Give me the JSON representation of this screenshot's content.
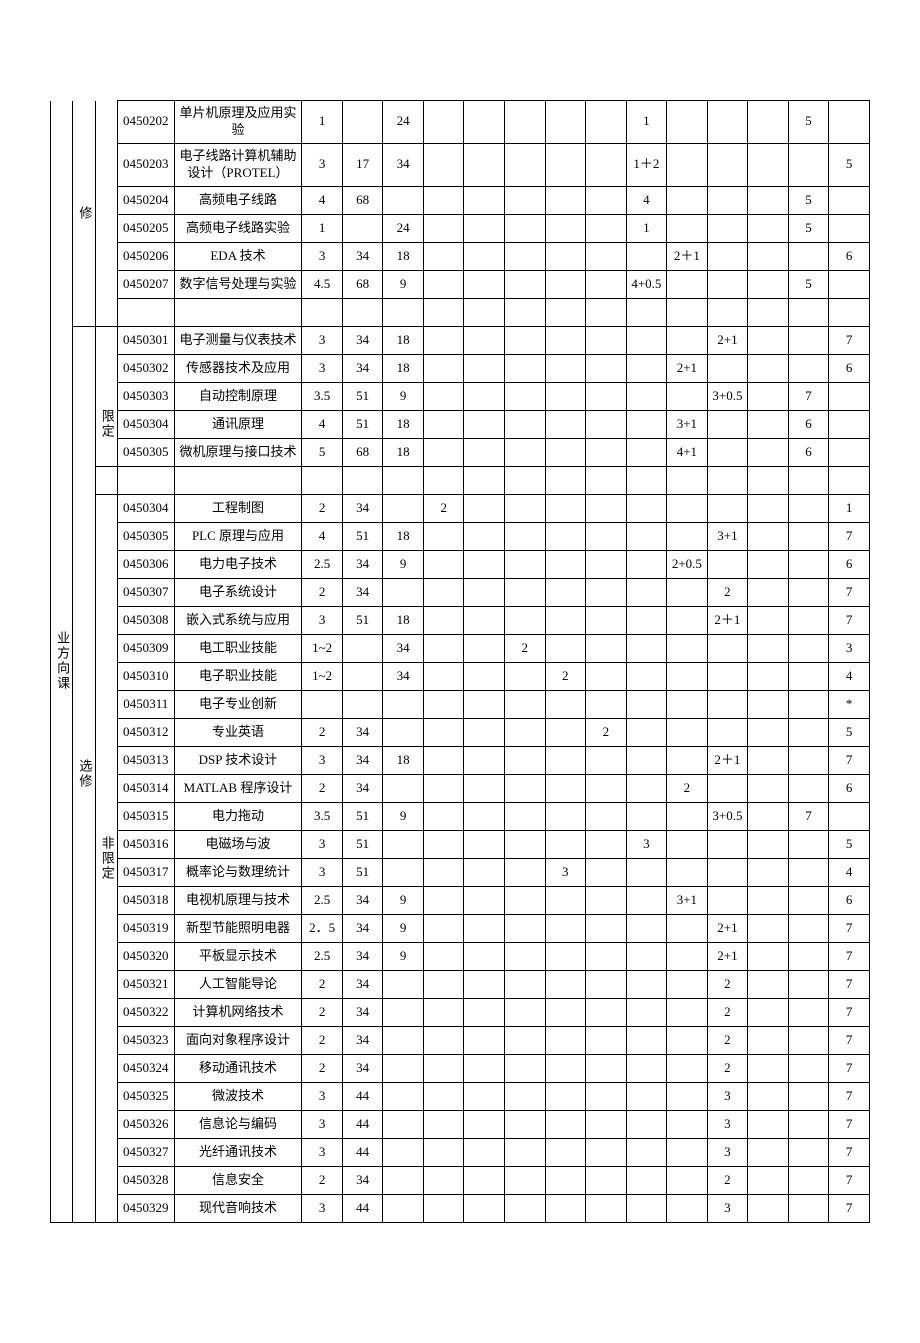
{
  "labels": {
    "category_top": "业方向课",
    "type_compulsory": "修",
    "type_elective": "选修",
    "sub_limited": "限定",
    "sub_unlimited": "非限定"
  },
  "sections": [
    {
      "key": "compulsory",
      "rows": [
        {
          "code": "0450202",
          "name": "单片机原理及应用实验",
          "c5": "1",
          "c6": "",
          "c7": "24",
          "c8": "",
          "c9": "",
          "c10": "",
          "c11": "",
          "c12": "",
          "c13": "1",
          "c14": "",
          "c15": "",
          "c16": "",
          "c17": "5",
          "c18": ""
        },
        {
          "code": "0450203",
          "name": "电子线路计算机辅助设计（PROTEL）",
          "c5": "3",
          "c6": "17",
          "c7": "34",
          "c8": "",
          "c9": "",
          "c10": "",
          "c11": "",
          "c12": "",
          "c13": "1＋2",
          "c14": "",
          "c15": "",
          "c16": "",
          "c17": "",
          "c18": "5"
        },
        {
          "code": "0450204",
          "name": "高频电子线路",
          "c5": "4",
          "c6": "68",
          "c7": "",
          "c8": "",
          "c9": "",
          "c10": "",
          "c11": "",
          "c12": "",
          "c13": "4",
          "c14": "",
          "c15": "",
          "c16": "",
          "c17": "5",
          "c18": ""
        },
        {
          "code": "0450205",
          "name": "高频电子线路实验",
          "c5": "1",
          "c6": "",
          "c7": "24",
          "c8": "",
          "c9": "",
          "c10": "",
          "c11": "",
          "c12": "",
          "c13": "1",
          "c14": "",
          "c15": "",
          "c16": "",
          "c17": "5",
          "c18": ""
        },
        {
          "code": "0450206",
          "name": "EDA 技术",
          "c5": "3",
          "c6": "34",
          "c7": "18",
          "c8": "",
          "c9": "",
          "c10": "",
          "c11": "",
          "c12": "",
          "c13": "",
          "c14": "2＋1",
          "c15": "",
          "c16": "",
          "c17": "",
          "c18": "6"
        },
        {
          "code": "0450207",
          "name": "数字信号处理与实验",
          "c5": "4.5",
          "c6": "68",
          "c7": "9",
          "c8": "",
          "c9": "",
          "c10": "",
          "c11": "",
          "c12": "",
          "c13": "4+0.5",
          "c14": "",
          "c15": "",
          "c16": "",
          "c17": "5",
          "c18": ""
        }
      ]
    },
    {
      "key": "limited",
      "rows": [
        {
          "code": "0450301",
          "name": "电子测量与仪表技术",
          "c5": "3",
          "c6": "34",
          "c7": "18",
          "c8": "",
          "c9": "",
          "c10": "",
          "c11": "",
          "c12": "",
          "c13": "",
          "c14": "",
          "c15": "2+1",
          "c16": "",
          "c17": "",
          "c18": "7"
        },
        {
          "code": "0450302",
          "name": "传感器技术及应用",
          "c5": "3",
          "c6": "34",
          "c7": "18",
          "c8": "",
          "c9": "",
          "c10": "",
          "c11": "",
          "c12": "",
          "c13": "",
          "c14": "2+1",
          "c15": "",
          "c16": "",
          "c17": "",
          "c18": "6"
        },
        {
          "code": "0450303",
          "name": "自动控制原理",
          "c5": "3.5",
          "c6": "51",
          "c7": "9",
          "c8": "",
          "c9": "",
          "c10": "",
          "c11": "",
          "c12": "",
          "c13": "",
          "c14": "",
          "c15": "3+0.5",
          "c16": "",
          "c17": "7",
          "c18": ""
        },
        {
          "code": "0450304",
          "name": "通讯原理",
          "c5": "4",
          "c6": "51",
          "c7": "18",
          "c8": "",
          "c9": "",
          "c10": "",
          "c11": "",
          "c12": "",
          "c13": "",
          "c14": "3+1",
          "c15": "",
          "c16": "",
          "c17": "6",
          "c18": ""
        },
        {
          "code": "0450305",
          "name": "微机原理与接口技术",
          "c5": "5",
          "c6": "68",
          "c7": "18",
          "c8": "",
          "c9": "",
          "c10": "",
          "c11": "",
          "c12": "",
          "c13": "",
          "c14": "4+1",
          "c15": "",
          "c16": "",
          "c17": "6",
          "c18": ""
        }
      ]
    },
    {
      "key": "unlimited",
      "rows": [
        {
          "code": "0450304",
          "name": "工程制图",
          "c5": "2",
          "c6": "34",
          "c7": "",
          "c8": "2",
          "c9": "",
          "c10": "",
          "c11": "",
          "c12": "",
          "c13": "",
          "c14": "",
          "c15": "",
          "c16": "",
          "c17": "",
          "c18": "1"
        },
        {
          "code": "0450305",
          "name": "PLC 原理与应用",
          "c5": "4",
          "c6": "51",
          "c7": "18",
          "c8": "",
          "c9": "",
          "c10": "",
          "c11": "",
          "c12": "",
          "c13": "",
          "c14": "",
          "c15": "3+1",
          "c16": "",
          "c17": "",
          "c18": "7"
        },
        {
          "code": "0450306",
          "name": "电力电子技术",
          "c5": "2.5",
          "c6": "34",
          "c7": "9",
          "c8": "",
          "c9": "",
          "c10": "",
          "c11": "",
          "c12": "",
          "c13": "",
          "c14": "2+0.5",
          "c15": "",
          "c16": "",
          "c17": "",
          "c18": "6"
        },
        {
          "code": "0450307",
          "name": "电子系统设计",
          "c5": "2",
          "c6": "34",
          "c7": "",
          "c8": "",
          "c9": "",
          "c10": "",
          "c11": "",
          "c12": "",
          "c13": "",
          "c14": "",
          "c15": "2",
          "c16": "",
          "c17": "",
          "c18": "7"
        },
        {
          "code": "0450308",
          "name": "嵌入式系统与应用",
          "c5": "3",
          "c6": "51",
          "c7": "18",
          "c8": "",
          "c9": "",
          "c10": "",
          "c11": "",
          "c12": "",
          "c13": "",
          "c14": "",
          "c15": "2＋1",
          "c16": "",
          "c17": "",
          "c18": "7"
        },
        {
          "code": "0450309",
          "name": "电工职业技能",
          "c5": "1~2",
          "c6": "",
          "c7": "34",
          "c8": "",
          "c9": "",
          "c10": "2",
          "c11": "",
          "c12": "",
          "c13": "",
          "c14": "",
          "c15": "",
          "c16": "",
          "c17": "",
          "c18": "3"
        },
        {
          "code": "0450310",
          "name": "电子职业技能",
          "c5": "1~2",
          "c6": "",
          "c7": "34",
          "c8": "",
          "c9": "",
          "c10": "",
          "c11": "2",
          "c12": "",
          "c13": "",
          "c14": "",
          "c15": "",
          "c16": "",
          "c17": "",
          "c18": "4"
        },
        {
          "code": "0450311",
          "name": "电子专业创新",
          "c5": "",
          "c6": "",
          "c7": "",
          "c8": "",
          "c9": "",
          "c10": "",
          "c11": "",
          "c12": "",
          "c13": "",
          "c14": "",
          "c15": "",
          "c16": "",
          "c17": "",
          "c18": "*"
        },
        {
          "code": "0450312",
          "name": "专业英语",
          "c5": "2",
          "c6": "34",
          "c7": "",
          "c8": "",
          "c9": "",
          "c10": "",
          "c11": "",
          "c12": "2",
          "c13": "",
          "c14": "",
          "c15": "",
          "c16": "",
          "c17": "",
          "c18": "5"
        },
        {
          "code": "0450313",
          "name": "DSP 技术设计",
          "c5": "3",
          "c6": "34",
          "c7": "18",
          "c8": "",
          "c9": "",
          "c10": "",
          "c11": "",
          "c12": "",
          "c13": "",
          "c14": "",
          "c15": "2＋1",
          "c16": "",
          "c17": "",
          "c18": "7"
        },
        {
          "code": "0450314",
          "name": "MATLAB 程序设计",
          "c5": "2",
          "c6": "34",
          "c7": "",
          "c8": "",
          "c9": "",
          "c10": "",
          "c11": "",
          "c12": "",
          "c13": "",
          "c14": "2",
          "c15": "",
          "c16": "",
          "c17": "",
          "c18": "6"
        },
        {
          "code": "0450315",
          "name": "电力拖动",
          "c5": "3.5",
          "c6": "51",
          "c7": "9",
          "c8": "",
          "c9": "",
          "c10": "",
          "c11": "",
          "c12": "",
          "c13": "",
          "c14": "",
          "c15": "3+0.5",
          "c16": "",
          "c17": "7",
          "c18": ""
        },
        {
          "code": "0450316",
          "name": "电磁场与波",
          "c5": "3",
          "c6": "51",
          "c7": "",
          "c8": "",
          "c9": "",
          "c10": "",
          "c11": "",
          "c12": "",
          "c13": "3",
          "c14": "",
          "c15": "",
          "c16": "",
          "c17": "",
          "c18": "5"
        },
        {
          "code": "0450317",
          "name": "概率论与数理统计",
          "c5": "3",
          "c6": "51",
          "c7": "",
          "c8": "",
          "c9": "",
          "c10": "",
          "c11": "3",
          "c12": "",
          "c13": "",
          "c14": "",
          "c15": "",
          "c16": "",
          "c17": "",
          "c18": "4"
        },
        {
          "code": "0450318",
          "name": "电视机原理与技术",
          "c5": "2.5",
          "c6": "34",
          "c7": "9",
          "c8": "",
          "c9": "",
          "c10": "",
          "c11": "",
          "c12": "",
          "c13": "",
          "c14": "3+1",
          "c15": "",
          "c16": "",
          "c17": "",
          "c18": "6"
        },
        {
          "code": "0450319",
          "name": "新型节能照明电器",
          "c5": "2．5",
          "c6": "34",
          "c7": "9",
          "c8": "",
          "c9": "",
          "c10": "",
          "c11": "",
          "c12": "",
          "c13": "",
          "c14": "",
          "c15": "2+1",
          "c16": "",
          "c17": "",
          "c18": "7"
        },
        {
          "code": "0450320",
          "name": "平板显示技术",
          "c5": "2.5",
          "c6": "34",
          "c7": "9",
          "c8": "",
          "c9": "",
          "c10": "",
          "c11": "",
          "c12": "",
          "c13": "",
          "c14": "",
          "c15": "2+1",
          "c16": "",
          "c17": "",
          "c18": "7"
        },
        {
          "code": "0450321",
          "name": "人工智能导论",
          "c5": "2",
          "c6": "34",
          "c7": "",
          "c8": "",
          "c9": "",
          "c10": "",
          "c11": "",
          "c12": "",
          "c13": "",
          "c14": "",
          "c15": "2",
          "c16": "",
          "c17": "",
          "c18": "7"
        },
        {
          "code": "0450322",
          "name": "计算机网络技术",
          "c5": "2",
          "c6": "34",
          "c7": "",
          "c8": "",
          "c9": "",
          "c10": "",
          "c11": "",
          "c12": "",
          "c13": "",
          "c14": "",
          "c15": "2",
          "c16": "",
          "c17": "",
          "c18": "7"
        },
        {
          "code": "0450323",
          "name": "面向对象程序设计",
          "c5": "2",
          "c6": "34",
          "c7": "",
          "c8": "",
          "c9": "",
          "c10": "",
          "c11": "",
          "c12": "",
          "c13": "",
          "c14": "",
          "c15": "2",
          "c16": "",
          "c17": "",
          "c18": "7"
        },
        {
          "code": "0450324",
          "name": "移动通讯技术",
          "c5": "2",
          "c6": "34",
          "c7": "",
          "c8": "",
          "c9": "",
          "c10": "",
          "c11": "",
          "c12": "",
          "c13": "",
          "c14": "",
          "c15": "2",
          "c16": "",
          "c17": "",
          "c18": "7"
        },
        {
          "code": "0450325",
          "name": "微波技术",
          "c5": "3",
          "c6": "44",
          "c7": "",
          "c8": "",
          "c9": "",
          "c10": "",
          "c11": "",
          "c12": "",
          "c13": "",
          "c14": "",
          "c15": "3",
          "c16": "",
          "c17": "",
          "c18": "7"
        },
        {
          "code": "0450326",
          "name": "信息论与编码",
          "c5": "3",
          "c6": "44",
          "c7": "",
          "c8": "",
          "c9": "",
          "c10": "",
          "c11": "",
          "c12": "",
          "c13": "",
          "c14": "",
          "c15": "3",
          "c16": "",
          "c17": "",
          "c18": "7"
        },
        {
          "code": "0450327",
          "name": "光纤通讯技术",
          "c5": "3",
          "c6": "44",
          "c7": "",
          "c8": "",
          "c9": "",
          "c10": "",
          "c11": "",
          "c12": "",
          "c13": "",
          "c14": "",
          "c15": "3",
          "c16": "",
          "c17": "",
          "c18": "7"
        },
        {
          "code": "0450328",
          "name": "信息安全",
          "c5": "2",
          "c6": "34",
          "c7": "",
          "c8": "",
          "c9": "",
          "c10": "",
          "c11": "",
          "c12": "",
          "c13": "",
          "c14": "",
          "c15": "2",
          "c16": "",
          "c17": "",
          "c18": "7"
        },
        {
          "code": "0450329",
          "name": "现代音响技术",
          "c5": "3",
          "c6": "44",
          "c7": "",
          "c8": "",
          "c9": "",
          "c10": "",
          "c11": "",
          "c12": "",
          "c13": "",
          "c14": "",
          "c15": "3",
          "c16": "",
          "c17": "",
          "c18": "7"
        }
      ]
    }
  ]
}
